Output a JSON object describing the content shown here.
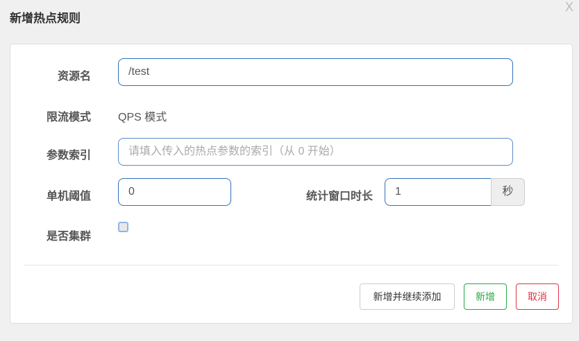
{
  "dialog": {
    "title": "新增热点规则",
    "close_label": "X"
  },
  "form": {
    "resource_label": "资源名",
    "resource_value": "/test",
    "mode_label": "限流模式",
    "mode_value": "QPS 模式",
    "param_label": "参数索引",
    "param_placeholder": "请填入传入的热点参数的索引（从 0 开始）",
    "threshold_label": "单机阈值",
    "threshold_value": "0",
    "window_label": "统计窗口时长",
    "window_value": "1",
    "window_unit": "秒",
    "cluster_label": "是否集群",
    "cluster_checked": false
  },
  "buttons": {
    "add_continue": "新增并继续添加",
    "add": "新增",
    "cancel": "取消"
  },
  "colors": {
    "add": "#28a745",
    "cancel": "#dc3545",
    "focus": "#2f6fb8"
  }
}
